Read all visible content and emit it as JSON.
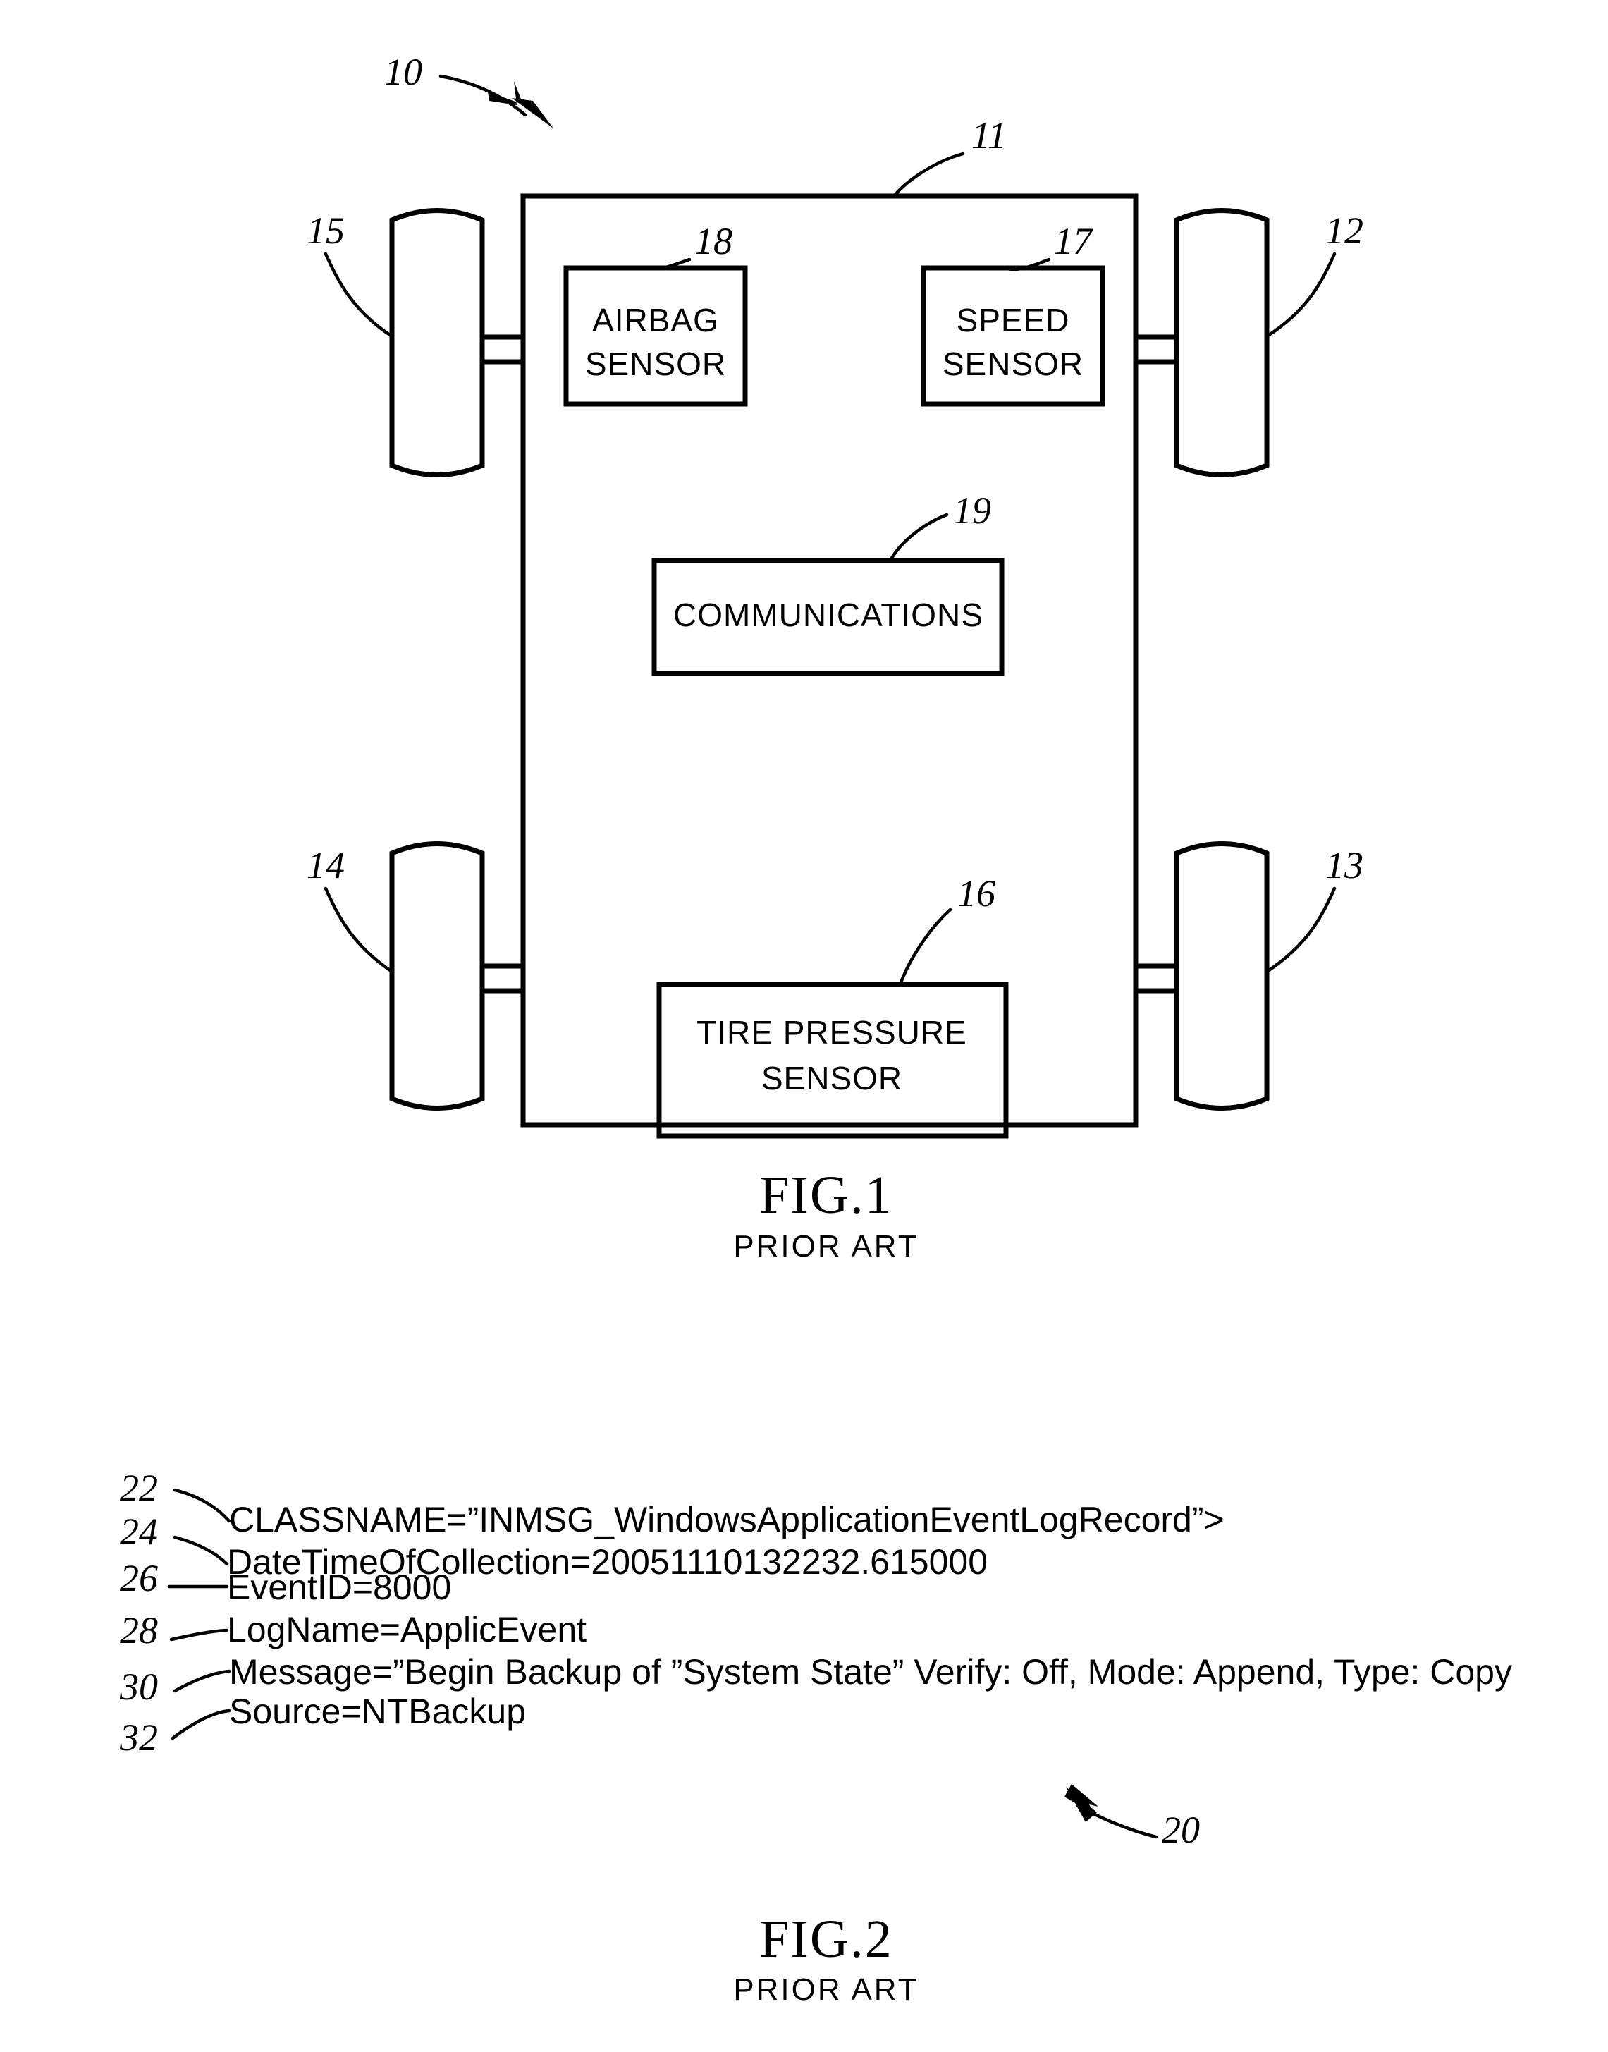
{
  "document": {
    "type": "patent-drawing-sheet",
    "figures": [
      {
        "id": "fig1",
        "caption": "FIG.1",
        "subcaption": "PRIOR ART",
        "system_ref": "10",
        "body_ref": "11",
        "wheels": [
          {
            "ref": "12",
            "position": "top-right"
          },
          {
            "ref": "13",
            "position": "bottom-right"
          },
          {
            "ref": "14",
            "position": "bottom-left"
          },
          {
            "ref": "15",
            "position": "top-left"
          }
        ],
        "modules": [
          {
            "ref": "18",
            "line1": "AIRBAG",
            "line2": "SENSOR"
          },
          {
            "ref": "17",
            "line1": "SPEED",
            "line2": "SENSOR"
          },
          {
            "ref": "19",
            "line1": "COMMUNICATIONS",
            "line2": ""
          },
          {
            "ref": "16",
            "line1": "TIRE  PRESSURE",
            "line2": "SENSOR"
          }
        ]
      },
      {
        "id": "fig2",
        "caption": "FIG.2",
        "subcaption": "PRIOR ART",
        "record_ref": "20",
        "lines": [
          {
            "ref": "22",
            "text": "CLASSNAME=”INMSG_WindowsApplicationEventLogRecord”>"
          },
          {
            "ref": "24",
            "text": "DateTimeOfCollection=20051110132232.615000"
          },
          {
            "ref": "26",
            "text": "EventID=8000"
          },
          {
            "ref": "28",
            "text": "LogName=ApplicEvent"
          },
          {
            "ref": "30",
            "text": "Message=”Begin  Backup  of  ”System  State”  Verify:  Off,  Mode:  Append,  Type:  Copy"
          },
          {
            "ref": "32",
            "text": "Source=NTBackup"
          }
        ]
      }
    ]
  },
  "colors": {
    "ink": "#000000",
    "paper": "#ffffff"
  }
}
